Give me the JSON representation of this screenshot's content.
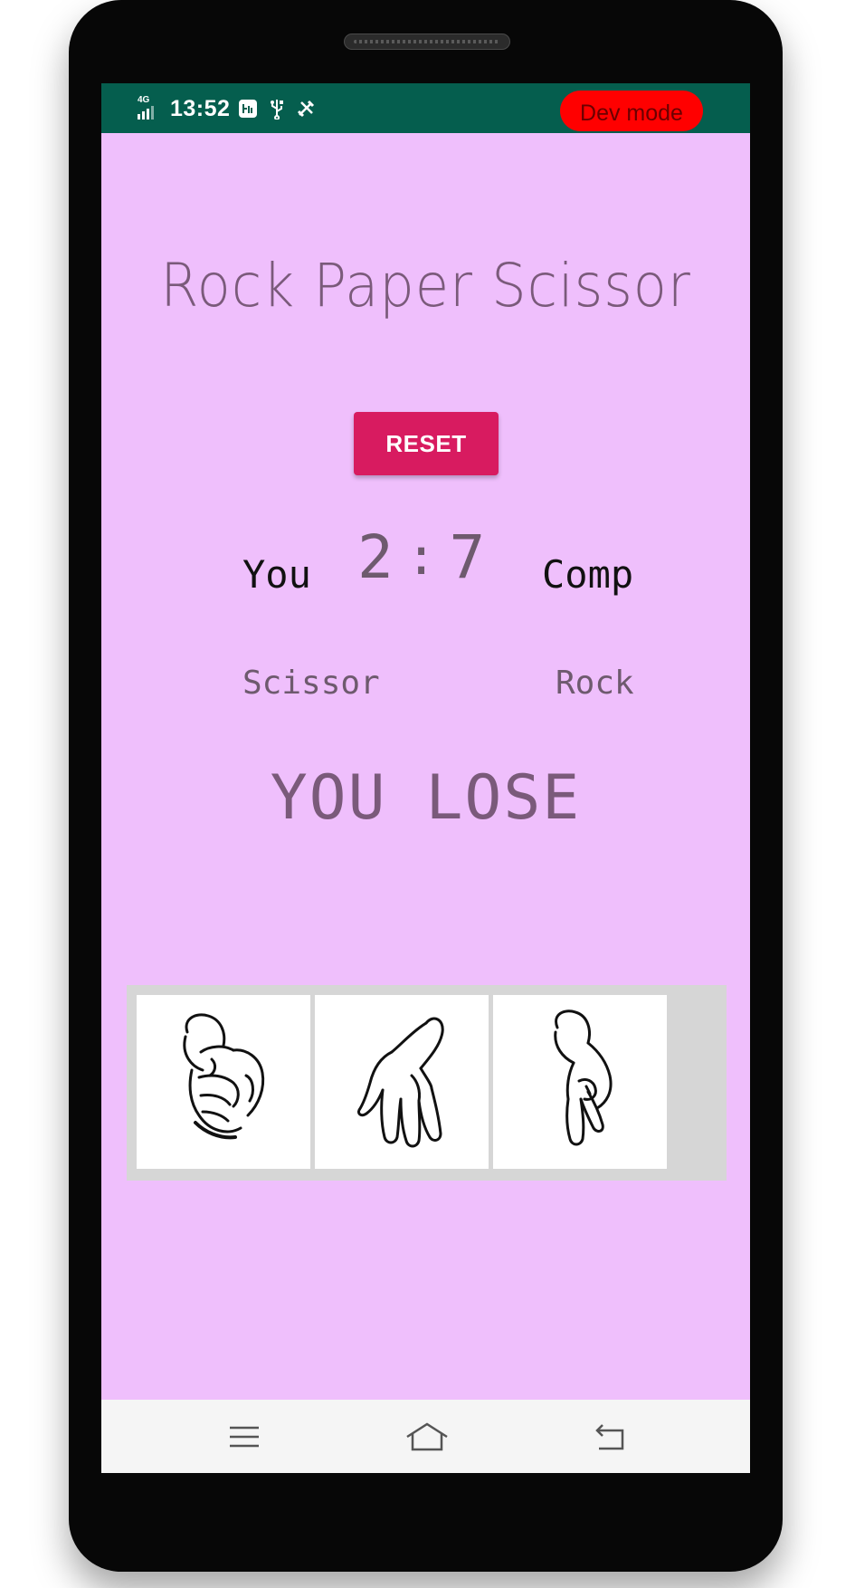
{
  "status_bar": {
    "network": "4G",
    "time": "13:52",
    "dev_mode_label": "Dev mode",
    "icons": [
      "signal-icon",
      "app-notification-icon",
      "usb-icon",
      "tools-icon"
    ]
  },
  "app": {
    "title": "Rock Paper Scissor",
    "reset_label": "RESET",
    "player_label": "You",
    "computer_label": "Comp",
    "player_score": "2",
    "score_separator": ":",
    "computer_score": "7",
    "player_choice": "Scissor",
    "computer_choice": "Rock",
    "result": "YOU LOSE"
  },
  "choices": [
    {
      "icon": "rock-hand-icon"
    },
    {
      "icon": "paper-hand-icon"
    },
    {
      "icon": "scissor-hand-icon"
    }
  ],
  "nav": {
    "icons": [
      "menu-icon",
      "home-icon",
      "back-icon"
    ]
  },
  "colors": {
    "status_bar": "#055e4e",
    "background": "#efbffc",
    "accent": "#d81b60",
    "dev_mode": "#ff0000",
    "panel": "#d6d6d6"
  }
}
